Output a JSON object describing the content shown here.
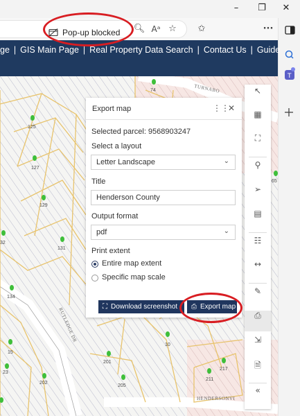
{
  "browser": {
    "popup_status": "Pop-up blocked",
    "reader_glyph": "Aᵃ",
    "window_buttons": [
      "–",
      "❐",
      "✕"
    ]
  },
  "site_nav": {
    "links": [
      "ge",
      "GIS Main Page",
      "Real Property Data Search",
      "Contact Us",
      "Guide"
    ]
  },
  "map": {
    "parcel_labels": [
      "74",
      "125",
      "127",
      "129",
      "131",
      "32",
      "134",
      "10",
      "15",
      "23",
      "201",
      "202",
      "205",
      "211",
      "217",
      "65"
    ],
    "road_labels": [
      "TURNABO",
      "RUTLEDGE DR",
      "HENDERSONVI"
    ]
  },
  "export_panel": {
    "title": "Export map",
    "selected_parcel": "Selected parcel: 9568903247",
    "layout_label": "Select a layout",
    "layout_value": "Letter Landscape",
    "title_label": "Title",
    "title_value": "Henderson County",
    "format_label": "Output format",
    "format_value": "pdf",
    "extent_label": "Print extent",
    "extent_options": [
      "Entire map extent",
      "Specific map scale"
    ],
    "extent_selected": "Entire map extent",
    "download_button": "Download screenshot",
    "export_button": "Export map"
  },
  "tools": {
    "items": [
      "select-tool",
      "basemap-tool",
      "zoom-extent-tool",
      "location-tool",
      "compass-tool",
      "image-tool",
      "print-layout-tool",
      "measure-tool",
      "edit-tool",
      "print-tool",
      "collapse-extent-tool",
      "export-file-tool",
      "collapse-tool"
    ],
    "active": "print-tool"
  },
  "colors": {
    "nav_bg": "#1f3a60",
    "button_bg": "#20365e",
    "annotation_red": "#d81d22",
    "parcel_line": "#e8c36c",
    "parcel_point": "#3fbf3a"
  }
}
